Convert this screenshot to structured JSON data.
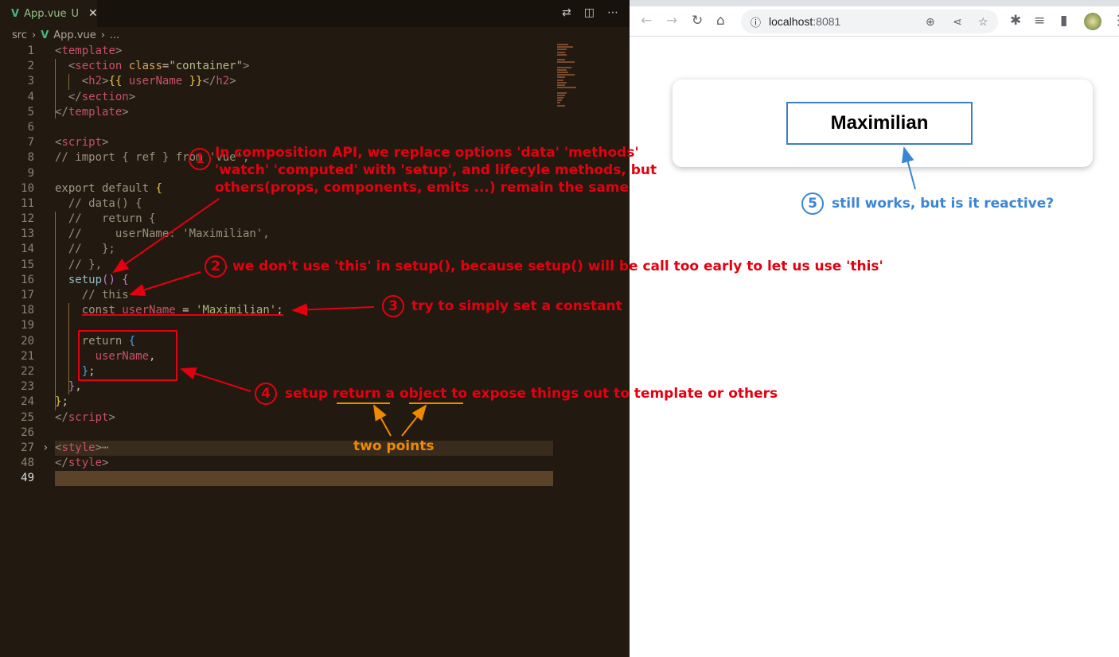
{
  "editor": {
    "tab": {
      "label": "App.vue",
      "status": "U"
    },
    "breadcrumb": [
      "src",
      "App.vue",
      "..."
    ],
    "lines": [
      {
        "n": "1",
        "t": [
          [
            "<",
            "br"
          ],
          [
            "template",
            "tag"
          ],
          [
            ">",
            "br"
          ]
        ]
      },
      {
        "n": "2",
        "t": [
          [
            "  <",
            "br"
          ],
          [
            "section",
            "tag"
          ],
          [
            " class",
            "attr"
          ],
          [
            "=",
            "pl"
          ],
          [
            "\"container\"",
            "str"
          ],
          [
            ">",
            "br"
          ]
        ]
      },
      {
        "n": "3",
        "t": [
          [
            "    <",
            "br"
          ],
          [
            "h2",
            "tag"
          ],
          [
            ">",
            "br"
          ],
          [
            "{{",
            "y"
          ],
          [
            " userName ",
            "v"
          ],
          [
            "}}",
            "y"
          ],
          [
            "</",
            "br"
          ],
          [
            "h2",
            "tag"
          ],
          [
            ">",
            "br"
          ]
        ]
      },
      {
        "n": "4",
        "t": [
          [
            "  </",
            "br"
          ],
          [
            "section",
            "tag"
          ],
          [
            ">",
            "br"
          ]
        ]
      },
      {
        "n": "5",
        "t": [
          [
            "</",
            "br"
          ],
          [
            "template",
            "tag"
          ],
          [
            ">",
            "br"
          ]
        ]
      },
      {
        "n": "6",
        "t": []
      },
      {
        "n": "7",
        "t": [
          [
            "<",
            "br"
          ],
          [
            "script",
            "tag"
          ],
          [
            ">",
            "br"
          ]
        ]
      },
      {
        "n": "8",
        "t": [
          [
            "// import { ref } from 'vue';",
            "cm"
          ]
        ]
      },
      {
        "n": "9",
        "t": []
      },
      {
        "n": "10",
        "t": [
          [
            "export default ",
            "kw"
          ],
          [
            "{",
            "y"
          ]
        ]
      },
      {
        "n": "11",
        "t": [
          [
            "  // data() {",
            "cm"
          ]
        ]
      },
      {
        "n": "12",
        "t": [
          [
            "  //   return {",
            "cm"
          ]
        ]
      },
      {
        "n": "13",
        "t": [
          [
            "  //     userName: 'Maximilian',",
            "cm"
          ]
        ]
      },
      {
        "n": "14",
        "t": [
          [
            "  //   };",
            "cm"
          ]
        ]
      },
      {
        "n": "15",
        "t": [
          [
            "  // },",
            "cm"
          ]
        ]
      },
      {
        "n": "16",
        "t": [
          [
            "  setup",
            "fn"
          ],
          [
            "()",
            "p"
          ],
          [
            " {",
            "p"
          ]
        ]
      },
      {
        "n": "17",
        "t": [
          [
            "    // this",
            "cm"
          ]
        ]
      },
      {
        "n": "18",
        "t": [
          [
            "    const ",
            "kw"
          ],
          [
            "userName",
            "v"
          ],
          [
            " = ",
            "pl"
          ],
          [
            "'Maximilian'",
            "s2"
          ],
          [
            ";",
            "pl"
          ]
        ]
      },
      {
        "n": "19",
        "t": []
      },
      {
        "n": "20",
        "t": [
          [
            "    return ",
            "kw"
          ],
          [
            "{",
            "b"
          ]
        ]
      },
      {
        "n": "21",
        "t": [
          [
            "      userName",
            "v"
          ],
          [
            ",",
            "pl"
          ]
        ]
      },
      {
        "n": "22",
        "t": [
          [
            "    }",
            "b"
          ],
          [
            ";",
            "pl"
          ]
        ]
      },
      {
        "n": "23",
        "t": [
          [
            "  }",
            "p"
          ],
          [
            ",",
            "pl"
          ]
        ]
      },
      {
        "n": "24",
        "t": [
          [
            "}",
            "y"
          ],
          [
            ";",
            "pl"
          ]
        ]
      },
      {
        "n": "25",
        "t": [
          [
            "</",
            "br"
          ],
          [
            "script",
            "tag"
          ],
          [
            ">",
            "br"
          ]
        ]
      },
      {
        "n": "26",
        "t": []
      },
      {
        "n": "27",
        "t": [
          [
            "<",
            "br"
          ],
          [
            "style",
            "tag"
          ],
          [
            ">",
            "br"
          ],
          [
            "⋯",
            "br"
          ]
        ],
        "fold": true
      },
      {
        "n": "48",
        "t": [
          [
            "</",
            "br"
          ],
          [
            "style",
            "tag"
          ],
          [
            ">",
            "br"
          ]
        ]
      },
      {
        "n": "49",
        "t": [],
        "current": true
      }
    ]
  },
  "browser": {
    "url_host": "localhost",
    "url_port": ":8081",
    "page": {
      "heading": "Maximilian"
    }
  },
  "annotations": {
    "a1": {
      "num": "1",
      "lines": [
        "In composition API, we replace options 'data' 'methods'",
        "'watch' 'computed' with 'setup', and lifecyle methods, but",
        "others(props, components, emits ...) remain the same"
      ]
    },
    "a2": {
      "num": "2",
      "text": "we don't use 'this' in setup(), because setup() will be call too early to let us use 'this'"
    },
    "a3": {
      "num": "3",
      "text": "try to simply set a constant"
    },
    "a4": {
      "num": "4",
      "pre": "setup ",
      "w1": "return",
      "mid": " a ",
      "w2": "object",
      "post": " to expose things out to template or others"
    },
    "two_points": "two points",
    "a5": {
      "num": "5",
      "text": "still works, but is it reactive?"
    }
  },
  "colors": {
    "annotation_red": "#e4000f",
    "annotation_blue": "#3a86d4",
    "annotation_orange": "#f08a00",
    "vue_green": "#41b883"
  }
}
